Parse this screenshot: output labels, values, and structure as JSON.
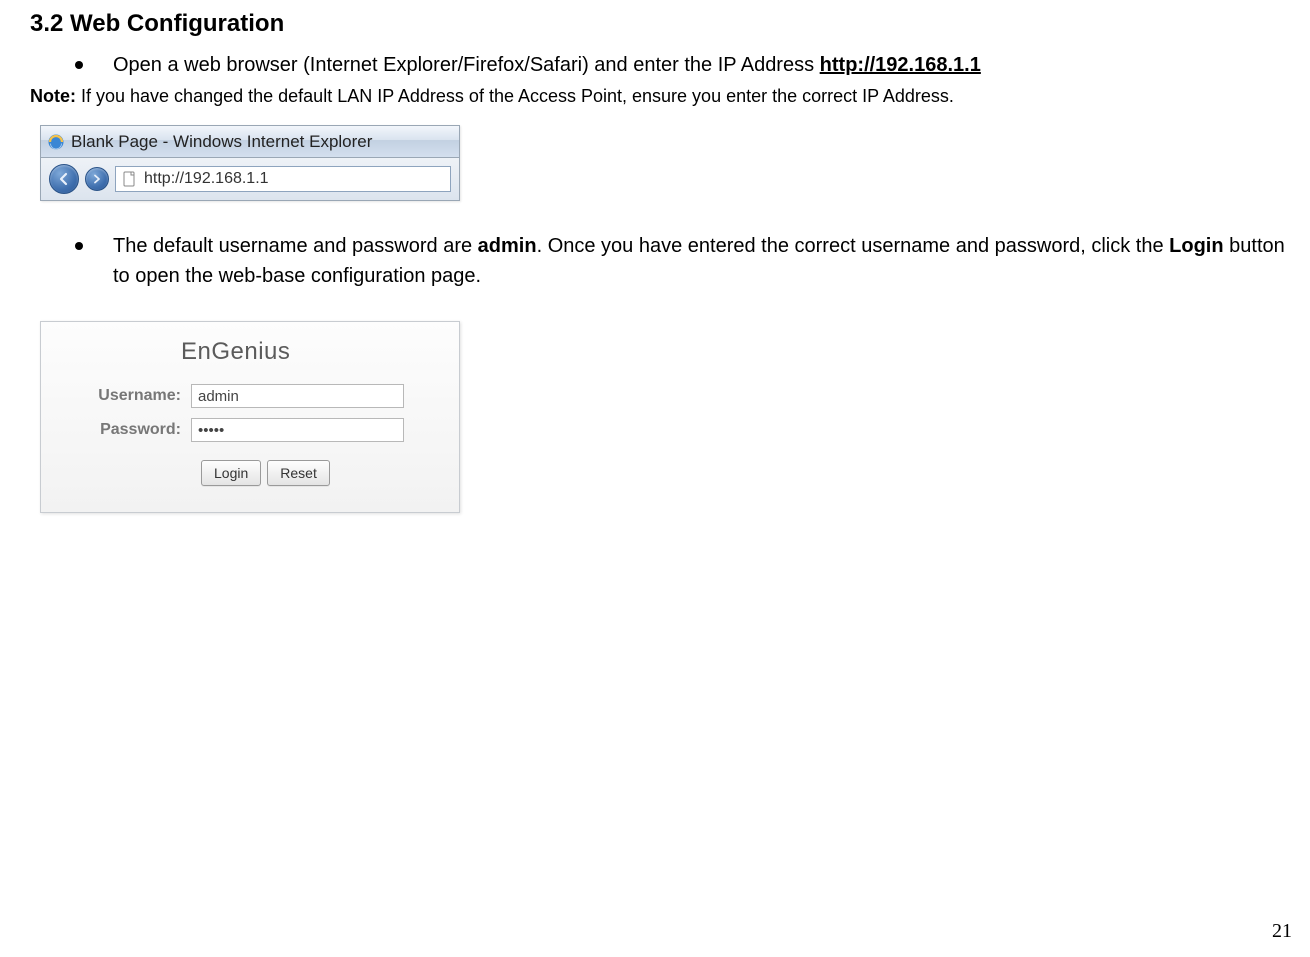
{
  "heading": "3.2   Web Configuration",
  "bullet1": {
    "prefix": "Open a web browser (Internet Explorer/Firefox/Safari) and enter the IP Address ",
    "url": "http://192.168.1.1"
  },
  "note": {
    "label": "Note:",
    "text": " If you have changed the default LAN IP Address of the Access Point, ensure you enter the correct IP Address."
  },
  "ie": {
    "title": "Blank Page - Windows Internet Explorer",
    "address": "http://192.168.1.1"
  },
  "bullet2": {
    "p1": "The default username and password are ",
    "admin": "admin",
    "p2": ". Once you have entered the correct username and password, click the ",
    "login": "Login",
    "p3": " button to open the web-base configuration page."
  },
  "login_panel": {
    "brand": "EnGenius",
    "username_label": "Username:",
    "password_label": "Password:",
    "username_value": "admin",
    "password_value": "•••••",
    "login_btn": "Login",
    "reset_btn": "Reset"
  },
  "page_number": "21"
}
